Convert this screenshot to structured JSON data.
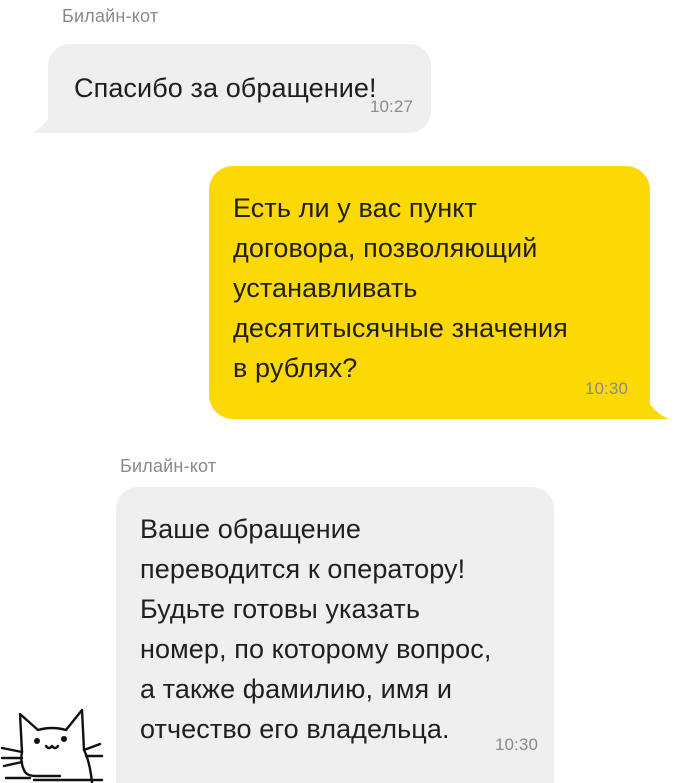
{
  "messages": [
    {
      "sender": "Билайн-кот",
      "text": "Спасибо за обращение!",
      "time": "10:27"
    },
    {
      "text": "Есть ли у вас пункт\nдоговора, позволяющий\nустанавливать\nдесятитысячные значения\nв рублях?",
      "time": "10:30"
    },
    {
      "sender": "Билайн-кот",
      "text": "Ваше обращение\nпереводится к оператору!\nБудьте готовы указать\nномер, по которому вопрос,\nа также фамилию, имя и\nотчество его владельца.",
      "time": "10:30"
    }
  ],
  "colors": {
    "incoming_bubble": "#efeff0",
    "outgoing_bubble": "#fdd904",
    "meta_text": "#8a8a8a"
  },
  "icons": {
    "bot_avatar": "cat-avatar-icon"
  }
}
